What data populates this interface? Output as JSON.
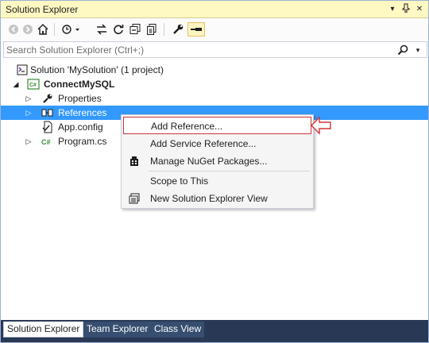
{
  "window": {
    "title": "Solution Explorer",
    "dropdown_glyph": "▾",
    "pin_glyph": "ᛘ",
    "close_glyph": "✕"
  },
  "toolbar": {
    "icons": [
      "back-icon",
      "forward-icon",
      "home-icon",
      "pending-changes-filter-icon",
      "sync-with-active-document-icon",
      "refresh-icon",
      "collapse-all-icon",
      "show-all-files-icon",
      "properties-icon",
      "preview-selected-items-icon"
    ]
  },
  "search": {
    "placeholder": "Search Solution Explorer (Ctrl+;)",
    "value": "",
    "dropdown_glyph": "▾"
  },
  "tree": {
    "items": [
      {
        "label": "Solution 'MySolution' (1 project)",
        "icon": "solution-icon",
        "expander": ""
      },
      {
        "label": "ConnectMySQL",
        "icon": "csharp-project-icon",
        "expander": "◢"
      },
      {
        "label": "Properties",
        "icon": "wrench-icon",
        "expander": "▷"
      },
      {
        "label": "References",
        "icon": "references-icon",
        "expander": "▷"
      },
      {
        "label": "App.config",
        "icon": "config-file-icon",
        "expander": ""
      },
      {
        "label": "Program.cs",
        "icon": "csharp-file-icon",
        "expander": "▷"
      }
    ],
    "selected_index": 3
  },
  "context_menu": {
    "items": [
      {
        "label": "Add Reference...",
        "icon": "",
        "highlighted": true
      },
      {
        "label": "Add Service Reference...",
        "icon": ""
      },
      {
        "label": "Manage NuGet Packages...",
        "icon": "nuget-package-icon"
      },
      {
        "label": "Scope to This",
        "icon": ""
      },
      {
        "label": "New Solution Explorer View",
        "icon": "new-view-icon"
      }
    ]
  },
  "bottom_tabs": {
    "items": [
      "Solution Explorer",
      "Team Explorer",
      "Class View"
    ],
    "active_index": 0
  },
  "colors": {
    "title_bar": "#fef8c2",
    "selection": "#3399ff",
    "highlight_border": "#d13438",
    "tab_strip": "#293955"
  }
}
